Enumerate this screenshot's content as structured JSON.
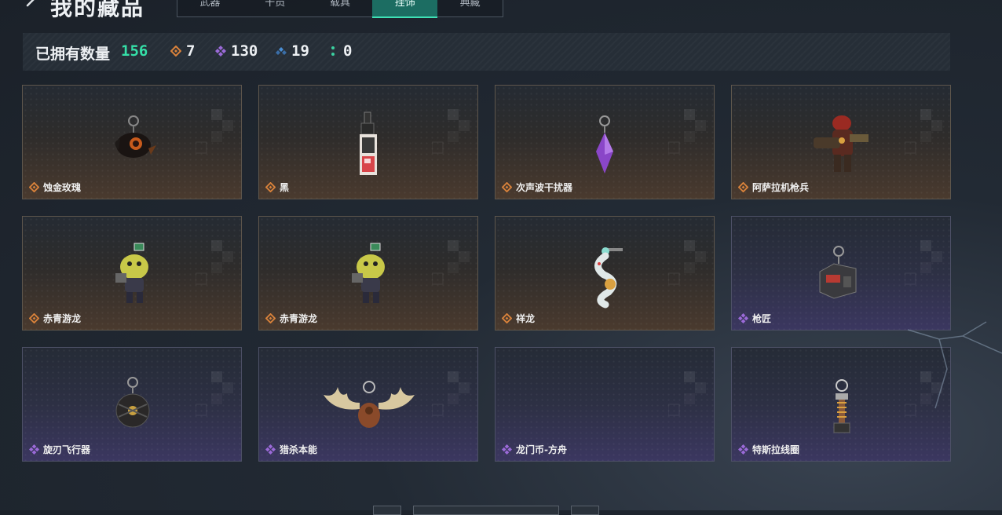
{
  "header": {
    "title": "我的藏品",
    "tabs": [
      {
        "label": "武器",
        "active": false
      },
      {
        "label": "干员",
        "active": false
      },
      {
        "label": "载具",
        "active": false
      },
      {
        "label": "挂饰",
        "active": true
      },
      {
        "label": "典藏",
        "active": false
      }
    ]
  },
  "owned": {
    "label": "已拥有数量",
    "total": "156",
    "rarities": [
      {
        "icon": "orange-diamond-icon",
        "color": "#d9823b",
        "count": "7"
      },
      {
        "icon": "purple-diamond-icon",
        "color": "#9b6ad8",
        "count": "130"
      },
      {
        "icon": "blue-diamond-icon",
        "color": "#4a8fd6",
        "count": "19"
      },
      {
        "icon": "green-dots-icon",
        "color": "#3bd1a0",
        "count": "0"
      }
    ]
  },
  "items": [
    {
      "name": "蚀金玫瑰",
      "rarity": "gold",
      "icon": "black-rose-charm-icon"
    },
    {
      "name": "黑",
      "rarity": "gold",
      "icon": "card-tag-charm-icon"
    },
    {
      "name": "次声波干扰器",
      "rarity": "gold",
      "icon": "purple-crystal-charm-icon"
    },
    {
      "name": "阿萨拉机枪兵",
      "rarity": "gold",
      "icon": "gunner-figure-charm-icon"
    },
    {
      "name": "赤青游龙",
      "rarity": "gold",
      "icon": "dragon-mascot-charm-icon"
    },
    {
      "name": "赤青游龙",
      "rarity": "gold",
      "icon": "dragon-mascot-charm-icon"
    },
    {
      "name": "祥龙",
      "rarity": "gold",
      "icon": "coiled-dragon-charm-icon"
    },
    {
      "name": "枪匠",
      "rarity": "purple",
      "icon": "gun-case-charm-icon"
    },
    {
      "name": "旋刃飞行器",
      "rarity": "purple",
      "icon": "drone-ball-charm-icon"
    },
    {
      "name": "猎杀本能",
      "rarity": "purple",
      "icon": "antler-trophy-charm-icon"
    },
    {
      "name": "龙门币-方舟",
      "rarity": "purple",
      "icon": "empty-slot"
    },
    {
      "name": "特斯拉线圈",
      "rarity": "purple",
      "icon": "tesla-coil-charm-icon"
    }
  ],
  "colors": {
    "accent_green": "#35e0a8",
    "gold_rarity": "#d9823b",
    "purple_rarity": "#9b6ad8"
  }
}
